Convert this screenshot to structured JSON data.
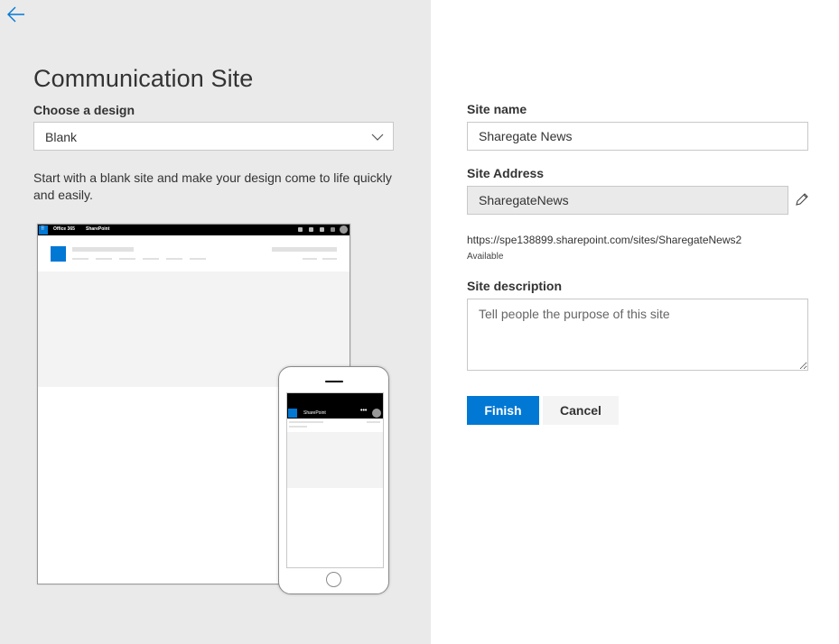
{
  "page": {
    "title": "Communication Site",
    "back_icon": "arrow-left-icon"
  },
  "design": {
    "label": "Choose a design",
    "selected": "Blank",
    "description": "Start with a blank site and make your design come to life quickly and easily."
  },
  "preview": {
    "desktop": {
      "suite_label": "Office 365",
      "app_label": "SharePoint"
    },
    "phone": {
      "app_label": "SharePoint",
      "more_label": "•••"
    }
  },
  "form": {
    "site_name": {
      "label": "Site name",
      "value": "Sharegate News"
    },
    "site_address": {
      "label": "Site Address",
      "value": "SharegateNews",
      "url": "https://spe138899.sharepoint.com/sites/SharegateNews2",
      "availability": "Available",
      "edit_icon": "pencil-icon"
    },
    "site_description": {
      "label": "Site description",
      "placeholder": "Tell people the purpose of this site"
    }
  },
  "actions": {
    "finish_label": "Finish",
    "cancel_label": "Cancel"
  },
  "colors": {
    "accent": "#0078d4",
    "left_pane_bg": "#eaeaea",
    "field_bg_readonly": "#eaeaea"
  }
}
